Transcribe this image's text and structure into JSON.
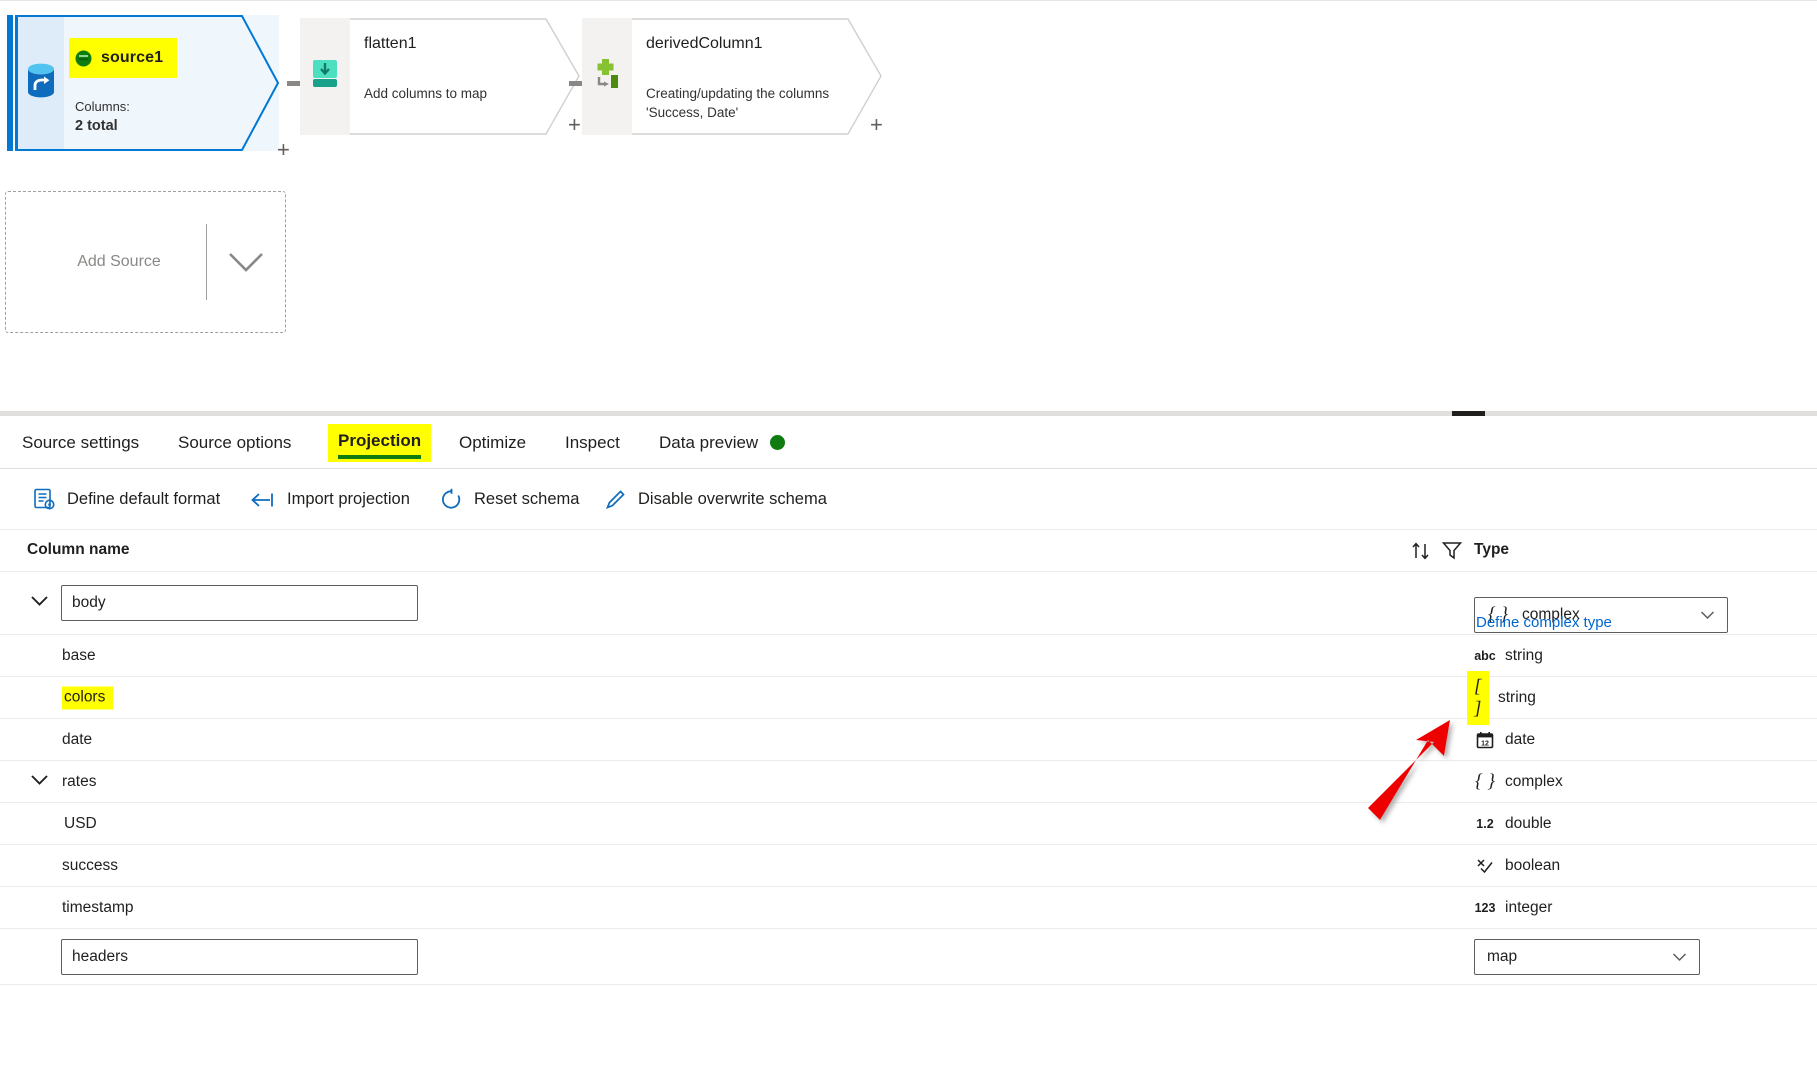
{
  "canvas": {
    "source_node": {
      "title": "source1",
      "columns_label": "Columns:",
      "columns_value": "2 total",
      "icon": "database-source-icon",
      "status_icon": "green-status-icon",
      "plus_label": "+"
    },
    "transform_nodes": [
      {
        "title": "flatten1",
        "description": "Add columns to map",
        "icon": "flatten-icon",
        "plus_label": "+"
      },
      {
        "title": "derivedColumn1",
        "description": "Creating/updating the columns 'Success, Date'",
        "icon": "derived-column-icon",
        "plus_label": "+"
      }
    ],
    "add_source": {
      "label": "Add Source",
      "chevron": "chevron-down-icon"
    }
  },
  "tabs": [
    {
      "label": "Source settings",
      "active": false
    },
    {
      "label": "Source options",
      "active": false
    },
    {
      "label": "Projection",
      "active": true,
      "highlighted": true
    },
    {
      "label": "Optimize",
      "active": false
    },
    {
      "label": "Inspect",
      "active": false
    },
    {
      "label": "Data preview",
      "active": false,
      "status_dot": true
    }
  ],
  "commands": [
    {
      "label": "Define default format",
      "icon": "define-format-icon"
    },
    {
      "label": "Import projection",
      "icon": "import-arrow-icon"
    },
    {
      "label": "Reset schema",
      "icon": "refresh-icon"
    },
    {
      "label": "Disable overwrite schema",
      "icon": "pencil-icon"
    }
  ],
  "table": {
    "headers": {
      "column_name": "Column name",
      "type": "Type",
      "sort_icon": "sort-icon",
      "filter_icon": "filter-icon"
    },
    "rows": [
      {
        "name": "body",
        "editable": true,
        "expandable": true,
        "expanded": true,
        "type": "complex",
        "type_icon": "{ }",
        "type_dropdown": true,
        "define_link": "Define complex type"
      },
      {
        "name": "base",
        "indent": 1,
        "type": "string",
        "type_icon": "abc"
      },
      {
        "name": "colors",
        "indent": 1,
        "type": "string",
        "type_icon": "[ ]",
        "name_highlighted": true,
        "type_icon_highlighted": true
      },
      {
        "name": "date",
        "indent": 1,
        "type": "date",
        "type_icon": "calendar"
      },
      {
        "name": "rates",
        "indent": 1,
        "expandable": true,
        "expanded": true,
        "type": "complex",
        "type_icon": "{ }"
      },
      {
        "name": "USD",
        "indent": 2,
        "type": "double",
        "type_icon": "1.2"
      },
      {
        "name": "success",
        "indent": 1,
        "type": "boolean",
        "type_icon": "boolean"
      },
      {
        "name": "timestamp",
        "indent": 1,
        "type": "integer",
        "type_icon": "123"
      },
      {
        "name": "headers",
        "editable": true,
        "type": "map",
        "type_dropdown": true
      }
    ]
  },
  "annotation": {
    "arrow_color": "#ee0000",
    "highlight_color": "#ffff00",
    "accent_color": "#0078d4",
    "link_color": "#0066cc",
    "status_green": "#107c10"
  }
}
